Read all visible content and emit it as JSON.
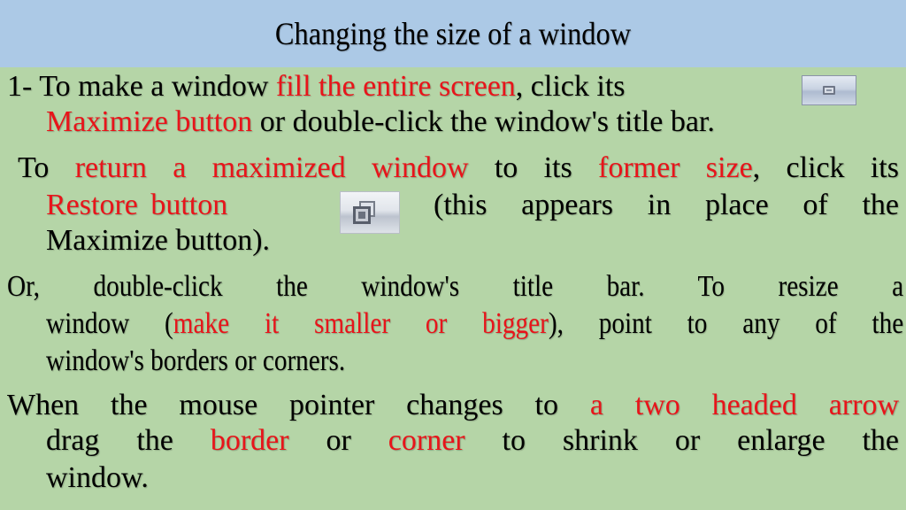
{
  "header": {
    "title": "Changing the size of a window"
  },
  "colors": {
    "background": "#b5d5a7",
    "header_background": "#acc9e6",
    "highlight": "#e8141a",
    "text": "#000000"
  },
  "icons": {
    "maximize": "maximize-button-icon",
    "restore": "restore-button-icon"
  },
  "lines": [
    {
      "parts": [
        {
          "text": "1- To make a window "
        },
        {
          "text": "fill the entire screen",
          "red": true
        },
        {
          "text": ", click its"
        }
      ]
    },
    {
      "parts": [
        {
          "text": "Maximize button",
          "red": true
        },
        {
          "text": " or double-click the window's title bar."
        }
      ]
    },
    {
      "parts": [
        {
          "text": "To "
        },
        {
          "text": "return a maximized window",
          "red": true
        },
        {
          "text": " to its "
        },
        {
          "text": "former size",
          "red": true
        },
        {
          "text": ", click its"
        }
      ]
    },
    {
      "parts": [
        {
          "text": "Restore button",
          "red": true
        }
      ]
    },
    {
      "parts": [
        {
          "text": "(this appears in place of the"
        }
      ]
    },
    {
      "parts": [
        {
          "text": "Maximize button)."
        }
      ]
    },
    {
      "parts": [
        {
          "text": "Or, double-click the window's title bar. To  resize a"
        }
      ]
    },
    {
      "parts": [
        {
          "text": "window ("
        },
        {
          "text": "make it smaller or bigger",
          "red": true
        },
        {
          "text": "), point to any of the"
        }
      ]
    },
    {
      "parts": [
        {
          "text": "window's borders or corners."
        }
      ]
    },
    {
      "parts": [
        {
          "text": "When the mouse pointer changes to "
        },
        {
          "text": "a two headed arrow",
          "red": true
        }
      ]
    },
    {
      "parts": [
        {
          "text": "drag the "
        },
        {
          "text": "border",
          "red": true
        },
        {
          "text": " or "
        },
        {
          "text": "corner",
          "red": true
        },
        {
          "text": " to shrink or enlarge the"
        }
      ]
    },
    {
      "parts": [
        {
          "text": "window."
        }
      ]
    }
  ]
}
